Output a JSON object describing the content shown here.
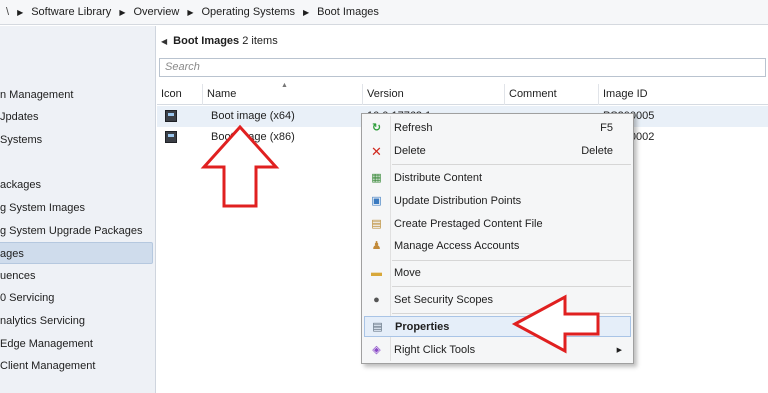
{
  "breadcrumb": {
    "back_glyph": "\\",
    "sep_glyph": "▶",
    "items": [
      "Software Library",
      "Overview",
      "Operating Systems",
      "Boot Images"
    ]
  },
  "sidebar": {
    "items": [
      {
        "label": "n Management",
        "selected": false
      },
      {
        "label": "Jpdates",
        "selected": false
      },
      {
        "label": "Systems",
        "selected": false
      },
      {
        "label": "ackages",
        "selected": false
      },
      {
        "label": "g System Images",
        "selected": false
      },
      {
        "label": "g System Upgrade Packages",
        "selected": false
      },
      {
        "label": "ages",
        "selected": true
      },
      {
        "label": "uences",
        "selected": false
      },
      {
        "label": "0 Servicing",
        "selected": false
      },
      {
        "label": "nalytics Servicing",
        "selected": false
      },
      {
        "label": "Edge Management",
        "selected": false
      },
      {
        "label": "Client Management",
        "selected": false
      }
    ]
  },
  "main": {
    "title_bold": "Boot Images",
    "title_count": "2 items",
    "search_placeholder": "Search",
    "columns": [
      "Icon",
      "Name",
      "Version",
      "Comment",
      "Image ID"
    ],
    "rows": [
      {
        "icon": "boot-image-icon",
        "name": "Boot image (x64)",
        "version": "10.0.17763.1",
        "comment": "",
        "image_id": "PS200005"
      },
      {
        "icon": "boot-image-icon",
        "name": "Boot image (x86)",
        "version": "",
        "comment": "",
        "image_id": "PS200002"
      }
    ]
  },
  "context_menu": {
    "items": [
      {
        "icon": "refresh-icon",
        "label": "Refresh",
        "key": "F5"
      },
      {
        "icon": "delete-icon",
        "label": "Delete",
        "key": "Delete"
      },
      {
        "icon": "distribute-content-icon",
        "label": "Distribute Content",
        "key": ""
      },
      {
        "icon": "update-distribution-icon",
        "label": "Update Distribution Points",
        "key": ""
      },
      {
        "icon": "prestaged-content-icon",
        "label": "Create Prestaged Content File",
        "key": ""
      },
      {
        "icon": "access-accounts-icon",
        "label": "Manage Access Accounts",
        "key": ""
      },
      {
        "icon": "move-icon",
        "label": "Move",
        "key": ""
      },
      {
        "icon": "security-scopes-icon",
        "label": "Set Security Scopes",
        "key": ""
      },
      {
        "icon": "properties-icon",
        "label": "Properties",
        "key": ""
      },
      {
        "icon": "right-click-tools-icon",
        "label": "Right Click Tools",
        "key": "",
        "submenu_glyph": "▶"
      }
    ]
  },
  "colors": {
    "annotation_arrow": "#e02020",
    "selected_row": "#e9f0f8",
    "menu_hover": "#e5eef9"
  }
}
